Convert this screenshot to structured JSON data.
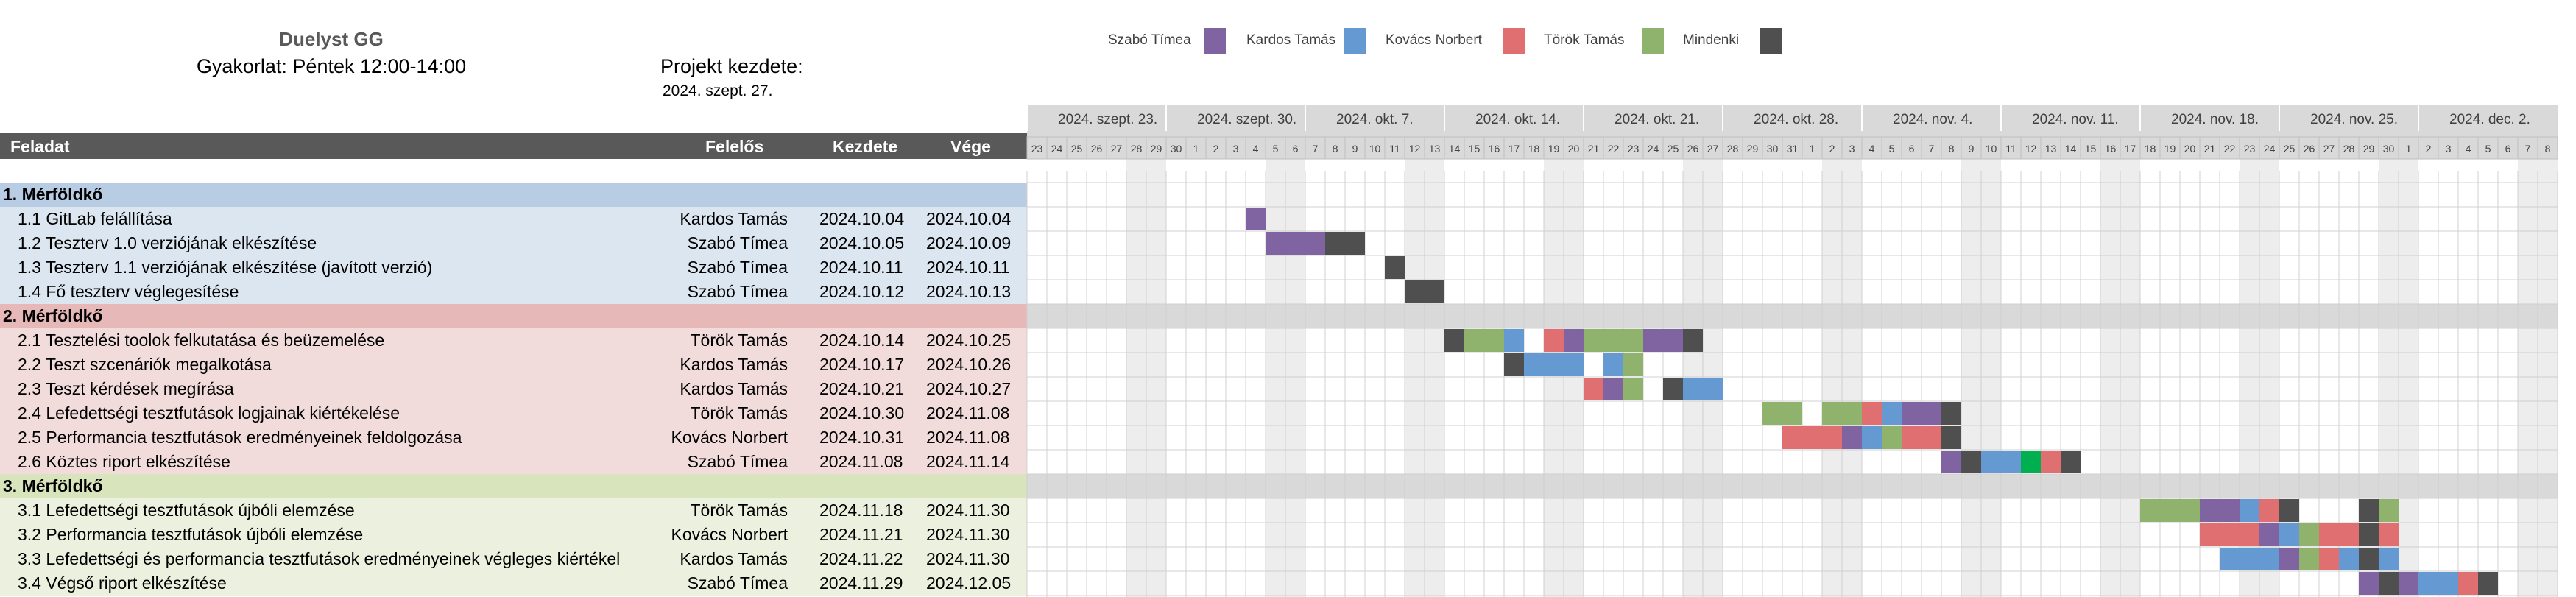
{
  "header": {
    "title": "Duelyst GG",
    "subtitle": "Gyakorlat: Péntek 12:00-14:00",
    "project_start_label": "Projekt kezdete:",
    "project_start_date": "2024. szept. 27."
  },
  "legend": [
    {
      "name": "Szabó Tímea",
      "color": "#8064a2"
    },
    {
      "name": "Kardos Tamás",
      "color": "#6599d2"
    },
    {
      "name": "Kovács Norbert",
      "color": "#e06f72"
    },
    {
      "name": "Török Tamás",
      "color": "#8fb36d"
    },
    {
      "name": "Mindenki",
      "color": "#4f4f4f"
    }
  ],
  "table": {
    "columns": [
      "Feladat",
      "Felelős",
      "Kezdete",
      "Vége"
    ]
  },
  "chart_data": {
    "type": "gantt",
    "timeline_start": "2024-09-23",
    "timeline_end": "2024-12-08",
    "week_labels": [
      "2024. szept. 23.",
      "2024. szept. 30.",
      "2024. okt. 7.",
      "2024. okt. 14.",
      "2024. okt. 21.",
      "2024. okt. 28.",
      "2024. nov. 4.",
      "2024. nov. 11.",
      "2024. nov. 18.",
      "2024. nov. 25.",
      "2024. dec. 2."
    ],
    "day_labels": [
      "23",
      "24",
      "25",
      "26",
      "27",
      "28",
      "29",
      "30",
      "1",
      "2",
      "3",
      "4",
      "5",
      "6",
      "7",
      "8",
      "9",
      "10",
      "11",
      "12",
      "13",
      "14",
      "15",
      "16",
      "17",
      "18",
      "19",
      "20",
      "21",
      "22",
      "23",
      "24",
      "25",
      "26",
      "27",
      "28",
      "29",
      "30",
      "31",
      "1",
      "2",
      "3",
      "4",
      "5",
      "6",
      "7",
      "8",
      "9",
      "10",
      "11",
      "12",
      "13",
      "14",
      "15",
      "16",
      "17",
      "18",
      "19",
      "20",
      "21",
      "22",
      "23",
      "24",
      "25",
      "26",
      "27",
      "28",
      "29",
      "30",
      "1",
      "2",
      "3",
      "4",
      "5",
      "6",
      "7",
      "8"
    ],
    "groups": [
      {
        "label": "1. Mérföldkő",
        "color": "#b8cce4",
        "row_color": "#dce6f1",
        "tasks": [
          {
            "name": "1.1 GitLab felállítása",
            "owner": "Kardos Tamás",
            "start": "2024.10.04",
            "end": "2024.10.04",
            "segments": [
              [
                "2024-10-04",
                "2024-10-04",
                "Szabó Tímea"
              ]
            ]
          },
          {
            "name": "1.2 Teszterv 1.0 verziójának elkészítése",
            "owner": "Szabó Tímea",
            "start": "2024.10.05",
            "end": "2024.10.09",
            "segments": [
              [
                "2024-10-05",
                "2024-10-07",
                "Szabó Tímea"
              ],
              [
                "2024-10-08",
                "2024-10-09",
                "Mindenki"
              ]
            ]
          },
          {
            "name": "1.3 Teszterv 1.1 verziójának elkészítése (javított verzió)",
            "owner": "Szabó Tímea",
            "start": "2024.10.11",
            "end": "2024.10.11",
            "segments": [
              [
                "2024-10-11",
                "2024-10-11",
                "Mindenki"
              ]
            ]
          },
          {
            "name": "1.4 Fő teszterv véglegesítése",
            "owner": "Szabó Tímea",
            "start": "2024.10.12",
            "end": "2024.10.13",
            "segments": [
              [
                "2024-10-12",
                "2024-10-13",
                "Mindenki"
              ]
            ]
          }
        ]
      },
      {
        "label": "2. Mérföldkő",
        "color": "#e6b8b7",
        "row_color": "#f2dcdb",
        "tasks": [
          {
            "name": "2.1 Tesztelési toolok felkutatása és beüzemelése",
            "owner": "Török Tamás",
            "start": "2024.10.14",
            "end": "2024.10.25",
            "segments": [
              [
                "2024-10-14",
                "2024-10-14",
                "Mindenki"
              ],
              [
                "2024-10-15",
                "2024-10-16",
                "Török Tamás"
              ],
              [
                "2024-10-17",
                "2024-10-17",
                "Kardos Tamás"
              ],
              [
                "2024-10-19",
                "2024-10-19",
                "Kovács Norbert"
              ],
              [
                "2024-10-20",
                "2024-10-20",
                "Szabó Tímea"
              ],
              [
                "2024-10-21",
                "2024-10-23",
                "Török Tamás"
              ],
              [
                "2024-10-24",
                "2024-10-25",
                "Szabó Tímea"
              ],
              [
                "2024-10-26",
                "2024-10-26",
                "Mindenki"
              ]
            ]
          },
          {
            "name": "2.2 Teszt szcenáriók megalkotása",
            "owner": "Kardos Tamás",
            "start": "2024.10.17",
            "end": "2024.10.26",
            "segments": [
              [
                "2024-10-17",
                "2024-10-17",
                "Mindenki"
              ],
              [
                "2024-10-18",
                "2024-10-20",
                "Kardos Tamás"
              ],
              [
                "2024-10-22",
                "2024-10-22",
                "Kardos Tamás"
              ],
              [
                "2024-10-23",
                "2024-10-23",
                "Török Tamás"
              ]
            ]
          },
          {
            "name": "2.3 Teszt kérdések megírása",
            "owner": "Kardos Tamás",
            "start": "2024.10.21",
            "end": "2024.10.27",
            "segments": [
              [
                "2024-10-21",
                "2024-10-21",
                "Kovács Norbert"
              ],
              [
                "2024-10-22",
                "2024-10-22",
                "Szabó Tímea"
              ],
              [
                "2024-10-23",
                "2024-10-23",
                "Török Tamás"
              ],
              [
                "2024-10-25",
                "2024-10-25",
                "Mindenki"
              ],
              [
                "2024-10-26",
                "2024-10-27",
                "Kardos Tamás"
              ]
            ]
          },
          {
            "name": "2.4 Lefedettségi tesztfutások logjainak kiértékelése",
            "owner": "Török Tamás",
            "start": "2024.10.30",
            "end": "2024.11.08",
            "segments": [
              [
                "2024-10-30",
                "2024-10-31",
                "Török Tamás"
              ],
              [
                "2024-11-02",
                "2024-11-03",
                "Török Tamás"
              ],
              [
                "2024-11-04",
                "2024-11-04",
                "Kovács Norbert"
              ],
              [
                "2024-11-05",
                "2024-11-05",
                "Kardos Tamás"
              ],
              [
                "2024-11-06",
                "2024-11-07",
                "Szabó Tímea"
              ],
              [
                "2024-11-08",
                "2024-11-08",
                "Mindenki"
              ]
            ]
          },
          {
            "name": "2.5 Performancia tesztfutások eredményeinek feldolgozása",
            "owner": "Kovács Norbert",
            "start": "2024.10.31",
            "end": "2024.11.08",
            "segments": [
              [
                "2024-10-31",
                "2024-11-02",
                "Kovács Norbert"
              ],
              [
                "2024-11-03",
                "2024-11-03",
                "Szabó Tímea"
              ],
              [
                "2024-11-04",
                "2024-11-04",
                "Kardos Tamás"
              ],
              [
                "2024-11-05",
                "2024-11-05",
                "Török Tamás"
              ],
              [
                "2024-11-06",
                "2024-11-07",
                "Kovács Norbert"
              ],
              [
                "2024-11-08",
                "2024-11-08",
                "Mindenki"
              ]
            ]
          },
          {
            "name": "2.6 Köztes riport elkészítése",
            "owner": "Szabó Tímea",
            "start": "2024.11.08",
            "end": "2024.11.14",
            "segments": [
              [
                "2024-11-08",
                "2024-11-08",
                "Szabó Tímea"
              ],
              [
                "2024-11-09",
                "2024-11-09",
                "Mindenki"
              ],
              [
                "2024-11-10",
                "2024-11-10",
                "Kardos Tamás"
              ],
              [
                "2024-11-11",
                "2024-11-11",
                "Kardos Tamás"
              ],
              [
                "2024-11-12",
                "2024-11-12",
                "Zöld"
              ],
              [
                "2024-11-13",
                "2024-11-13",
                "Kovács Norbert"
              ],
              [
                "2024-11-14",
                "2024-11-14",
                "Mindenki"
              ]
            ]
          }
        ]
      },
      {
        "label": "3. Mérföldkő",
        "color": "#d8e4bc",
        "row_color": "#ebf1de",
        "tasks": [
          {
            "name": "3.1 Lefedettségi tesztfutások újbóli elemzése",
            "owner": "Török Tamás",
            "start": "2024.11.18",
            "end": "2024.11.30",
            "segments": [
              [
                "2024-11-18",
                "2024-11-20",
                "Török Tamás"
              ],
              [
                "2024-11-21",
                "2024-11-22",
                "Szabó Tímea"
              ],
              [
                "2024-11-23",
                "2024-11-23",
                "Kardos Tamás"
              ],
              [
                "2024-11-24",
                "2024-11-24",
                "Kovács Norbert"
              ],
              [
                "2024-11-25",
                "2024-11-25",
                "Mindenki"
              ],
              [
                "2024-11-29",
                "2024-11-29",
                "Mindenki"
              ],
              [
                "2024-11-30",
                "2024-11-30",
                "Török Tamás"
              ]
            ]
          },
          {
            "name": "3.2 Performancia tesztfutások újbóli elemzése",
            "owner": "Kovács Norbert",
            "start": "2024.11.21",
            "end": "2024.11.30",
            "segments": [
              [
                "2024-11-21",
                "2024-11-23",
                "Kovács Norbert"
              ],
              [
                "2024-11-24",
                "2024-11-24",
                "Szabó Tímea"
              ],
              [
                "2024-11-25",
                "2024-11-25",
                "Kardos Tamás"
              ],
              [
                "2024-11-26",
                "2024-11-26",
                "Török Tamás"
              ],
              [
                "2024-11-27",
                "2024-11-28",
                "Kovács Norbert"
              ],
              [
                "2024-11-29",
                "2024-11-29",
                "Mindenki"
              ],
              [
                "2024-11-30",
                "2024-11-30",
                "Kovács Norbert"
              ]
            ]
          },
          {
            "name": "3.3 Lefedettségi és performancia tesztfutások eredményeinek végleges kiértékel",
            "owner": "Kardos Tamás",
            "start": "2024.11.22",
            "end": "2024.11.30",
            "segments": [
              [
                "2024-11-22",
                "2024-11-24",
                "Kardos Tamás"
              ],
              [
                "2024-11-25",
                "2024-11-25",
                "Szabó Tímea"
              ],
              [
                "2024-11-26",
                "2024-11-26",
                "Török Tamás"
              ],
              [
                "2024-11-27",
                "2024-11-27",
                "Kovács Norbert"
              ],
              [
                "2024-11-28",
                "2024-11-28",
                "Kardos Tamás"
              ],
              [
                "2024-11-29",
                "2024-11-29",
                "Mindenki"
              ],
              [
                "2024-11-30",
                "2024-11-30",
                "Kardos Tamás"
              ]
            ]
          },
          {
            "name": "3.4 Végső riport elkészítése",
            "owner": "Szabó Tímea",
            "start": "2024.11.29",
            "end": "2024.12.05",
            "segments": [
              [
                "2024-11-29",
                "2024-11-29",
                "Szabó Tímea"
              ],
              [
                "2024-11-30",
                "2024-11-30",
                "Mindenki"
              ],
              [
                "2024-12-01",
                "2024-12-01",
                "Szabó Tímea"
              ],
              [
                "2024-12-02",
                "2024-12-03",
                "Kardos Tamás"
              ],
              [
                "2024-12-04",
                "2024-12-04",
                "Kovács Norbert"
              ],
              [
                "2024-12-05",
                "2024-12-05",
                "Mindenki"
              ]
            ]
          }
        ]
      }
    ]
  }
}
